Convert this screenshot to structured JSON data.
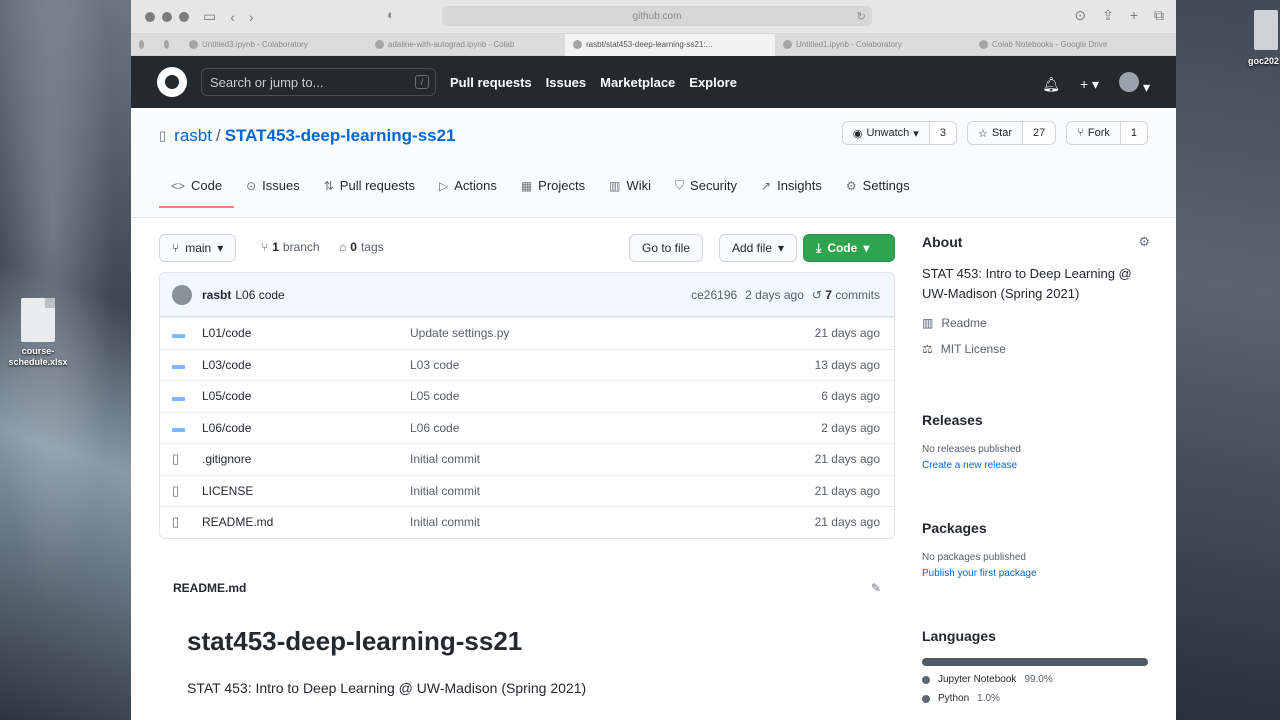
{
  "desktop": {
    "file_icon_label": "course-schedule.xlsx",
    "right_label": "goc202"
  },
  "browser": {
    "url": "github.com",
    "tabs": [
      {
        "label": "Untitled3.ipynb - Colaboratory"
      },
      {
        "label": "adaline-with-autograd.ipynb - Colab"
      },
      {
        "label": "rasbt/stat453-deep-learning-ss21:..."
      },
      {
        "label": "Untitled1.ipynb - Colaboratory"
      },
      {
        "label": "Colab Notebooks - Google Drive"
      }
    ]
  },
  "github": {
    "search_placeholder": "Search or jump to...",
    "search_key": "/",
    "nav": [
      "Pull requests",
      "Issues",
      "Marketplace",
      "Explore"
    ]
  },
  "repo": {
    "owner": "rasbt",
    "separator": "/",
    "name": "STAT453-deep-learning-ss21",
    "unwatch_label": "Unwatch",
    "unwatch_count": "3",
    "star_label": "Star",
    "star_count": "27",
    "fork_label": "Fork",
    "fork_count": "1",
    "tabs": [
      "Code",
      "Issues",
      "Pull requests",
      "Actions",
      "Projects",
      "Wiki",
      "Security",
      "Insights",
      "Settings"
    ]
  },
  "files_nav": {
    "branch": "main",
    "branch_count": "1",
    "branch_word": "branch",
    "tag_count": "0",
    "tag_word": "tags",
    "go_to_file": "Go to file",
    "add_file": "Add file",
    "code_button": "Code"
  },
  "commit": {
    "user": "rasbt",
    "message": "L06 code",
    "hash": "ce26196",
    "time": "2 days ago",
    "commit_count": "7",
    "commit_word": "commits"
  },
  "files": [
    {
      "name": "L01/code",
      "message": "Update settings.py",
      "age": "21 days ago",
      "type": "folder"
    },
    {
      "name": "L03/code",
      "message": "L03 code",
      "age": "13 days ago",
      "type": "folder"
    },
    {
      "name": "L05/code",
      "message": "L05 code",
      "age": "6 days ago",
      "type": "folder"
    },
    {
      "name": "L06/code",
      "message": "L06 code",
      "age": "2 days ago",
      "type": "folder"
    },
    {
      "name": ".gitignore",
      "message": "Initial commit",
      "age": "21 days ago",
      "type": "file"
    },
    {
      "name": "LICENSE",
      "message": "Initial commit",
      "age": "21 days ago",
      "type": "file"
    },
    {
      "name": "README.md",
      "message": "Initial commit",
      "age": "21 days ago",
      "type": "file"
    }
  ],
  "readme": {
    "filename": "README.md",
    "heading": "stat453-deep-learning-ss21",
    "paragraph": "STAT 453: Intro to Deep Learning @ UW-Madison (Spring 2021)"
  },
  "sidebar": {
    "about_title": "About",
    "about_text": "STAT 453: Intro to Deep Learning @ UW-Madison (Spring 2021)",
    "readme_link": "Readme",
    "license_link": "MIT License",
    "releases_title": "Releases",
    "releases_none": "No releases published",
    "releases_create": "Create a new release",
    "packages_title": "Packages",
    "packages_none": "No packages published",
    "packages_publish": "Publish your first package",
    "languages_title": "Languages",
    "languages": [
      {
        "name": "Jupyter Notebook",
        "pct": "99.0%"
      },
      {
        "name": "Python",
        "pct": "1.0%"
      }
    ]
  }
}
